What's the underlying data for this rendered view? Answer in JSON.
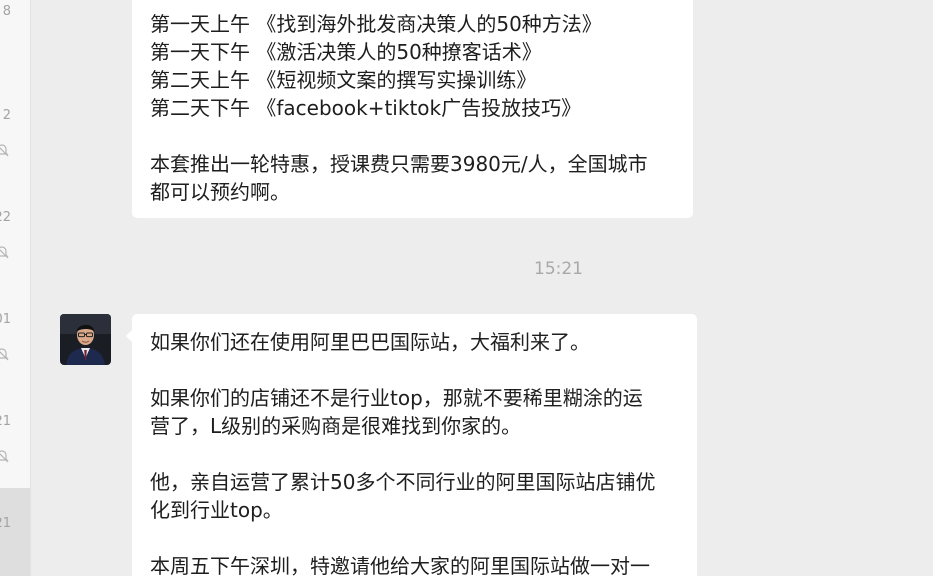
{
  "session_list": {
    "times": [
      "8",
      "2",
      "22",
      "01",
      "21",
      "21"
    ]
  },
  "chat": {
    "timestamp": "15:21",
    "message1": {
      "lines": [
        "第一天上午 《找到海外批发商决策人的50种方法》",
        "第一天下午 《激活决策人的50种撩客话术》",
        "第二天上午 《短视频文案的撰写实操训练》",
        "第二天下午 《facebook+tiktok广告投放技巧》",
        "本套推出一轮特惠，授课费只需要3980元/人，全国城市",
        "都可以预约啊。"
      ]
    },
    "message2": {
      "lines": [
        "如果你们还在使用阿里巴巴国际站，大福利来了。",
        "如果你们的店铺还不是行业top，那就不要稀里糊涂的运",
        "营了，L级别的采购商是很难找到你家的。",
        "他，亲自运营了累计50多个不同行业的阿里国际站店铺优",
        "化到行业top。",
        "本周五下午深圳，特邀请他给大家的阿里国际站做一对一"
      ]
    }
  }
}
